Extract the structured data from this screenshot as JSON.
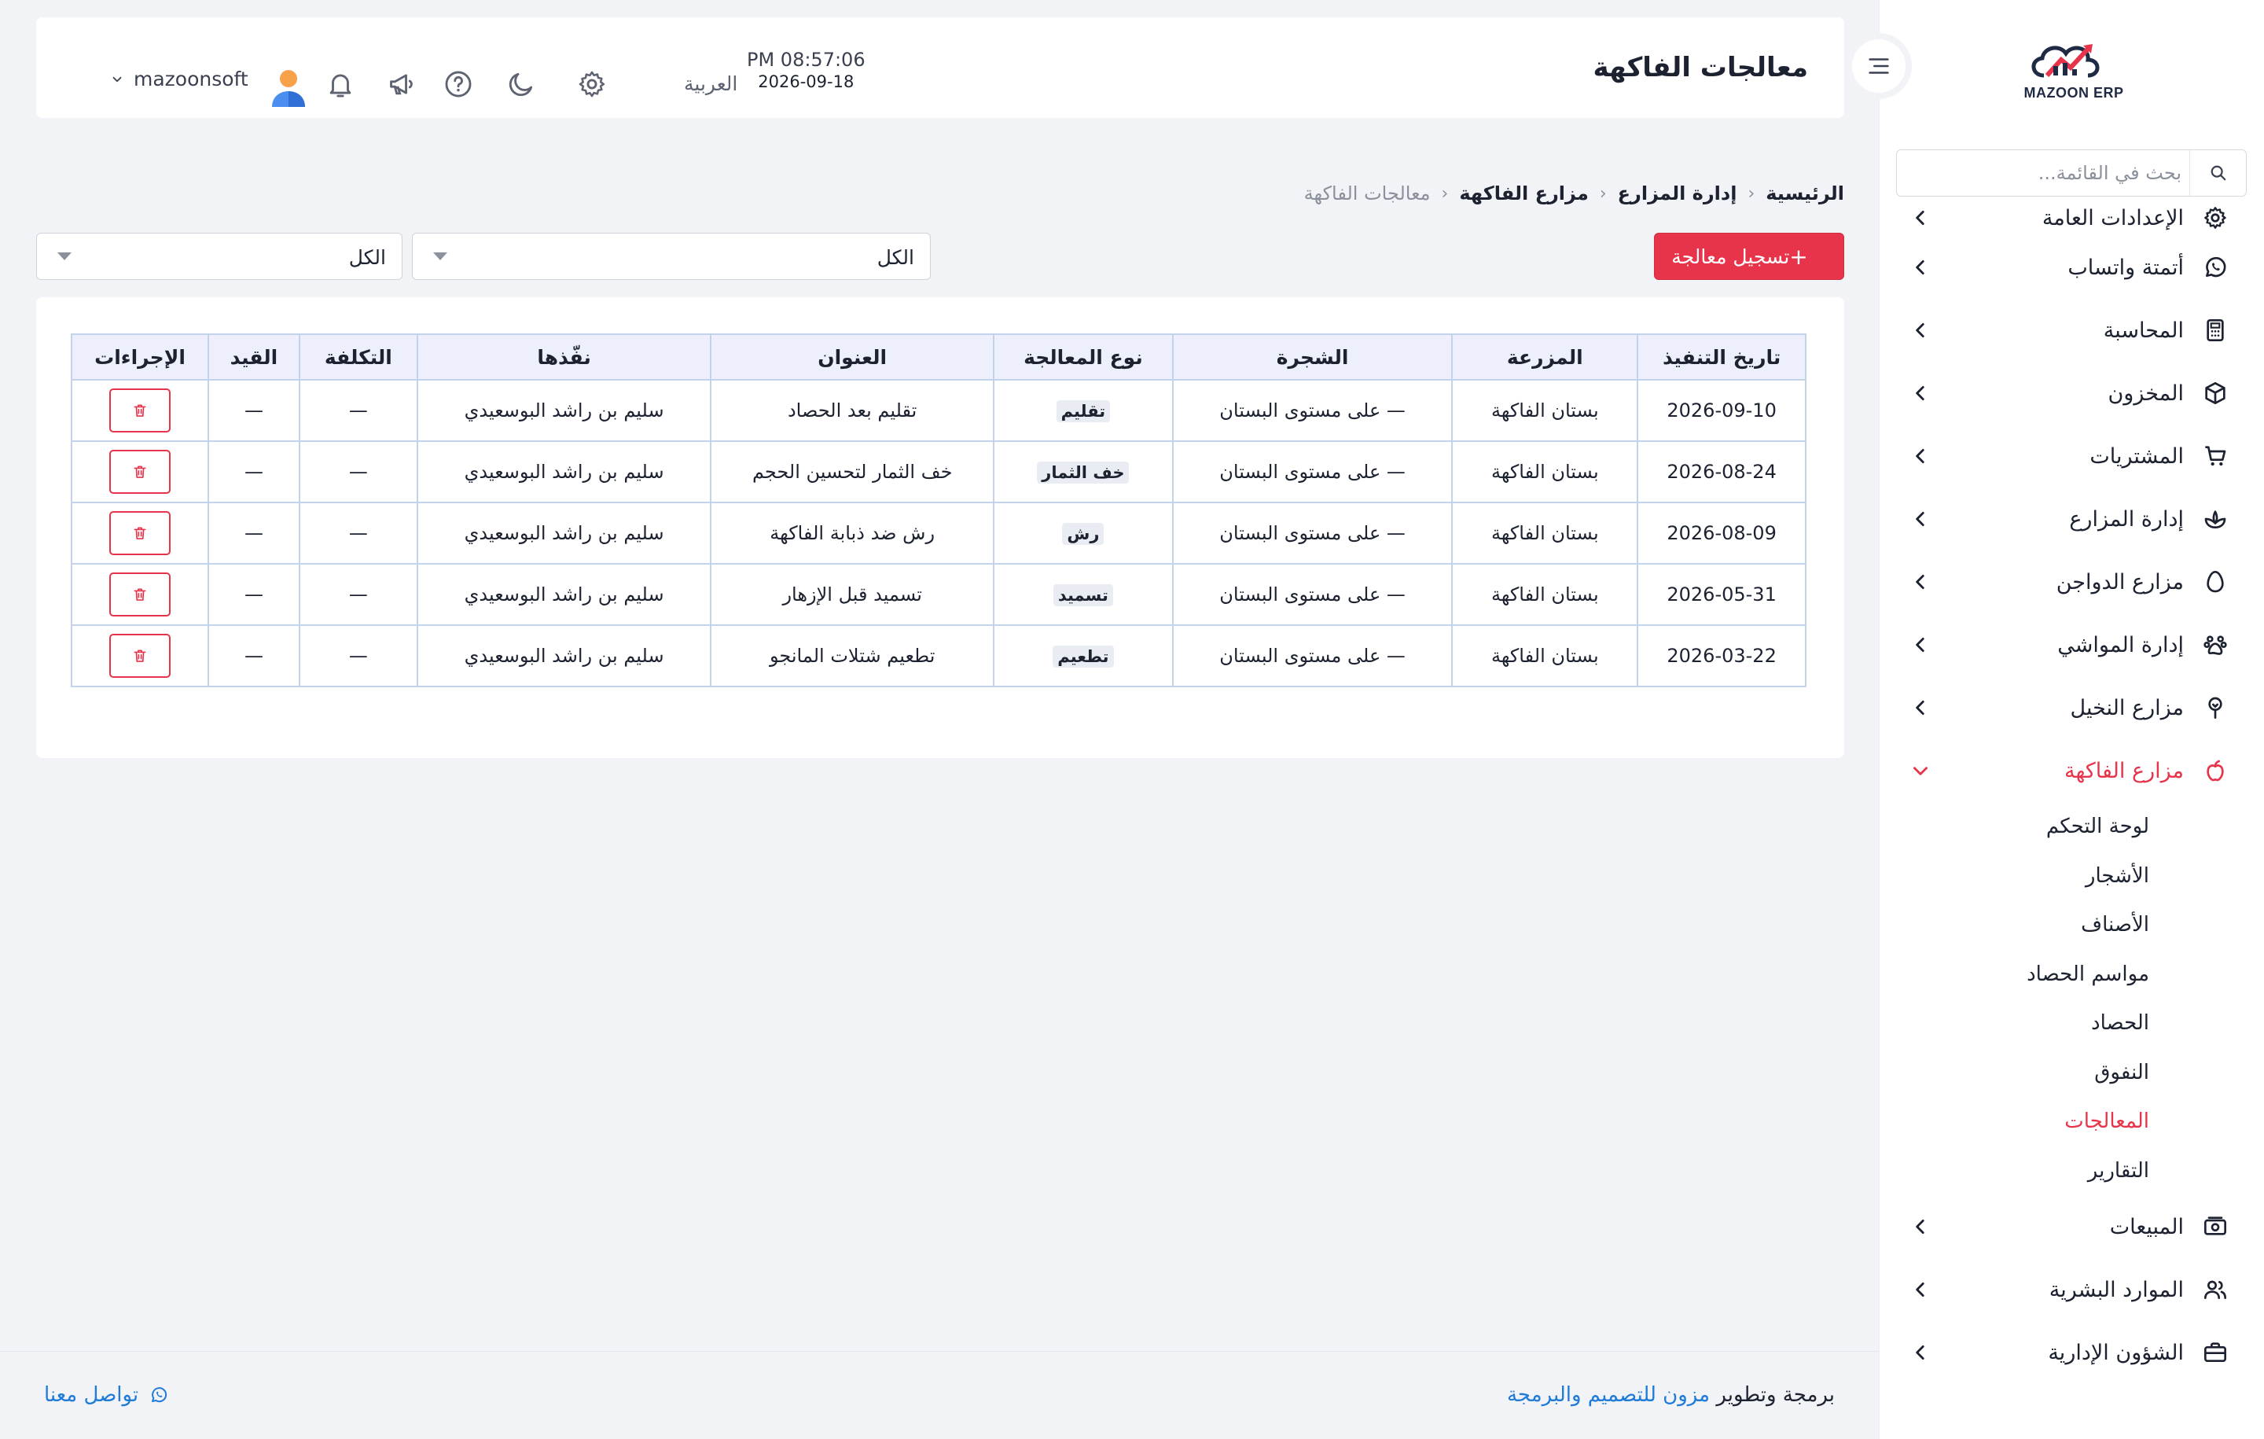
{
  "brand": {
    "name": "MAZOON ERP",
    "colors": {
      "accent": "#e8344a",
      "link": "#1e7bd8"
    }
  },
  "sidebar": {
    "search_placeholder": "بحث في القائمة...",
    "items": [
      {
        "label": "الإعدادات العامة",
        "icon": "gear-icon"
      },
      {
        "label": "أتمتة واتساب",
        "icon": "whatsapp-icon"
      },
      {
        "label": "المحاسبة",
        "icon": "calculator-icon"
      },
      {
        "label": "المخزون",
        "icon": "box-icon"
      },
      {
        "label": "المشتريات",
        "icon": "cart-icon"
      },
      {
        "label": "إدارة المزارع",
        "icon": "sprout-icon"
      },
      {
        "label": "مزارع الدواجن",
        "icon": "egg-icon"
      },
      {
        "label": "إدارة المواشي",
        "icon": "paw-icon"
      },
      {
        "label": "مزارع النخيل",
        "icon": "palm-icon"
      },
      {
        "label": "مزارع الفاكهة",
        "icon": "apple-icon",
        "active": true
      },
      {
        "label": "المبيعات",
        "icon": "register-icon"
      },
      {
        "label": "الموارد البشرية",
        "icon": "users-icon"
      },
      {
        "label": "الشؤون الإدارية",
        "icon": "briefcase-icon"
      }
    ],
    "submenu": [
      {
        "label": "لوحة التحكم"
      },
      {
        "label": "الأشجار"
      },
      {
        "label": "الأصناف"
      },
      {
        "label": "مواسم الحصاد"
      },
      {
        "label": "الحصاد"
      },
      {
        "label": "النفوق"
      },
      {
        "label": "المعالجات",
        "active": true
      },
      {
        "label": "التقارير"
      }
    ]
  },
  "header": {
    "title": "معالجات الفاكهة",
    "time": "PM 08:57:06",
    "date": "2026-09-18",
    "language": "العربية",
    "username": "mazoonsoft"
  },
  "breadcrumb": [
    "الرئيسية",
    "إدارة المزارع",
    "مزارع الفاكهة",
    "معالجات الفاكهة"
  ],
  "toolbar": {
    "add_label": "تسجيل معالجة",
    "filter1_value": "الكل",
    "filter2_value": "الكل"
  },
  "table": {
    "columns": [
      "تاريخ التنفيذ",
      "المزرعة",
      "الشجرة",
      "نوع المعالجة",
      "العنوان",
      "نفّذها",
      "التكلفة",
      "القيد",
      "الإجراءات"
    ],
    "rows": [
      {
        "date": "2026-09-10",
        "farm": "بستان الفاكهة",
        "tree": "— على مستوى البستان",
        "type": "تقليم",
        "title": "تقليم بعد الحصاد",
        "by": "سليم بن راشد البوسعيدي",
        "cost": "—",
        "entry": "—"
      },
      {
        "date": "2026-08-24",
        "farm": "بستان الفاكهة",
        "tree": "— على مستوى البستان",
        "type": "خف الثمار",
        "title": "خف الثمار لتحسين الحجم",
        "by": "سليم بن راشد البوسعيدي",
        "cost": "—",
        "entry": "—"
      },
      {
        "date": "2026-08-09",
        "farm": "بستان الفاكهة",
        "tree": "— على مستوى البستان",
        "type": "رش",
        "title": "رش ضد ذبابة الفاكهة",
        "by": "سليم بن راشد البوسعيدي",
        "cost": "—",
        "entry": "—"
      },
      {
        "date": "2026-05-31",
        "farm": "بستان الفاكهة",
        "tree": "— على مستوى البستان",
        "type": "تسميد",
        "title": "تسميد قبل الإزهار",
        "by": "سليم بن راشد البوسعيدي",
        "cost": "—",
        "entry": "—"
      },
      {
        "date": "2026-03-22",
        "farm": "بستان الفاكهة",
        "tree": "— على مستوى البستان",
        "type": "تطعيم",
        "title": "تطعيم شتلات المانجو",
        "by": "سليم بن راشد البوسعيدي",
        "cost": "—",
        "entry": "—"
      }
    ]
  },
  "footer": {
    "credit_prefix": "برمجة وتطوير",
    "credit_link": "مزون للتصميم والبرمجة",
    "contact": "تواصل معنا"
  }
}
